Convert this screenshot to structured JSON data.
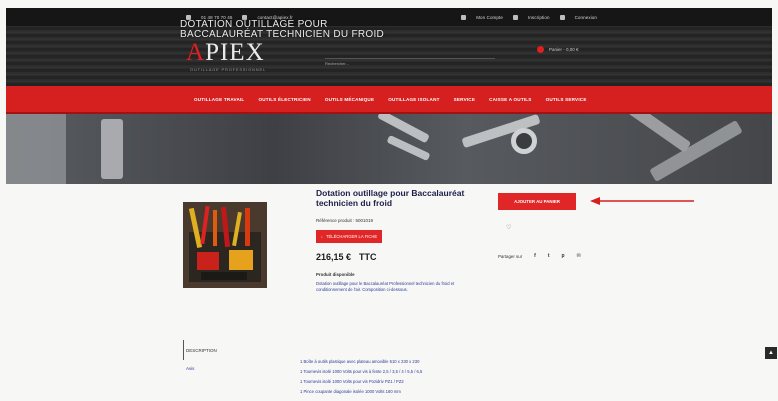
{
  "topbar": {
    "phone": "01 48 70 70 45",
    "email": "contact@apiex.fr",
    "account": "Mon Compte",
    "register": "Inscription",
    "login": "Connexion"
  },
  "header": {
    "logo_accent": "A",
    "logo_rest": "PIEX",
    "tagline": "OUTILLAGE PROFESSIONNEL",
    "search_placeholder": "Rechercher...",
    "cart_label": "Panier - 0,00 €"
  },
  "nav": {
    "items": [
      "OUTILLAGE TRAVAIL",
      "OUTILS ÉLECTRICIEN",
      "OUTILS MÉCANIQUE",
      "OUTILLAGE ISOLANT",
      "SERVICE",
      "CAISSE A OUTILS",
      "OUTILS SERVICE"
    ]
  },
  "hero": {
    "line1": "DOTATION OUTILLAGE POUR",
    "line2": "BACCALAURÉAT TECHNICIEN DU FROID"
  },
  "product": {
    "name": "Dotation outillage pour Baccalauréat technicien du froid",
    "reference": "Référence produit : 5001019",
    "fiche_button": "TÉLÉCHARGER LA FICHE",
    "price": "216,15 €",
    "ttc": "TTC",
    "availability": "Produit disponible",
    "description": "Dotation outillage pour le Baccalauréat Professionnel technicien du froid et conditionnement de l'air. Composition ci-dessous.",
    "add_to_cart": "AJOUTER AU PANIER",
    "favorite_icon": "heart-icon",
    "share_label": "Partager sur",
    "share_icons": [
      "f",
      "t",
      "p",
      "✉"
    ]
  },
  "sidebar": {
    "section_label": "DESCRIPTION",
    "link": "Avis"
  },
  "specs": [
    "1 Boîte à outils plastique avec plateau amovible 510 x 230 x 230",
    "1 Tournevis isolé 1000 Volts pour vis à fente 2,5 / 3,5 / 4 / 5,5 / 6,5",
    "1 Tournevis isolé 1000 Volts pour vis Pozidriv PZ1 / PZ2",
    "1 Pince coupante diagonale isolée 1000 Volts 160 mm"
  ],
  "colors": {
    "brand_red": "#d61f1f",
    "link_blue": "#2c3b9a",
    "dark": "#161616"
  },
  "scroll_top_icon": "chevron-up-icon"
}
